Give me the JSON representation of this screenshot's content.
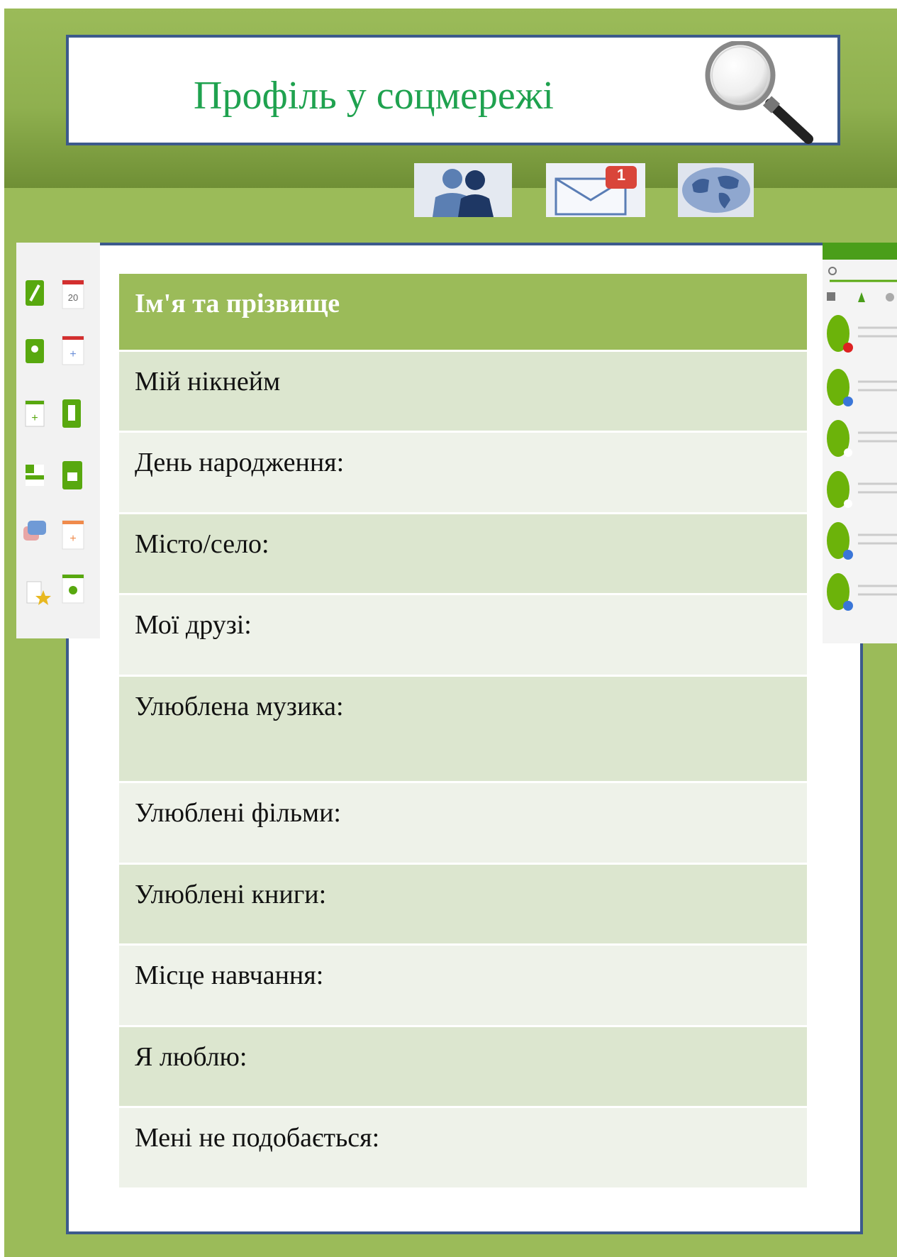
{
  "header": {
    "title": "Профіль у соцмережі"
  },
  "icons": {
    "search": "magnifying-glass-icon",
    "friends": "friends-icon",
    "messages": "mail-icon",
    "world": "globe-icon",
    "message_badge": "1"
  },
  "profile": {
    "fields": [
      {
        "label": "Ім'я та прізвище"
      },
      {
        "label": "Мій нікнейм"
      },
      {
        "label": "День народження:"
      },
      {
        "label": "Місто/село:"
      },
      {
        "label": "Мої друзі:"
      },
      {
        "label": "Улюблена музика:"
      },
      {
        "label": "Улюблені фільми:"
      },
      {
        "label": "Улюблені книги:"
      },
      {
        "label": "Місце навчання:"
      },
      {
        "label": "Я люблю:"
      },
      {
        "label": "Мені не подобається:"
      }
    ]
  },
  "left_sidebar": {
    "calendar_day": "20",
    "icons": [
      "edit-icon",
      "calendar-icon",
      "group-icon",
      "calendar-add-icon",
      "add-page-icon",
      "bookmark-icon",
      "layout-icon",
      "like-icon",
      "chat-icon",
      "calendar-plus-icon",
      "favorites-icon",
      "group-calendar-icon"
    ]
  },
  "right_sidebar": {
    "contacts": [
      "contact-busy",
      "contact-away",
      "contact-online",
      "contact-online",
      "contact-away",
      "contact-away"
    ]
  },
  "colors": {
    "accent": "#9bbb59",
    "title": "#1fa24f",
    "border": "#3c5a8c",
    "row_a": "#dce6cf",
    "row_b": "#eef2e9"
  }
}
